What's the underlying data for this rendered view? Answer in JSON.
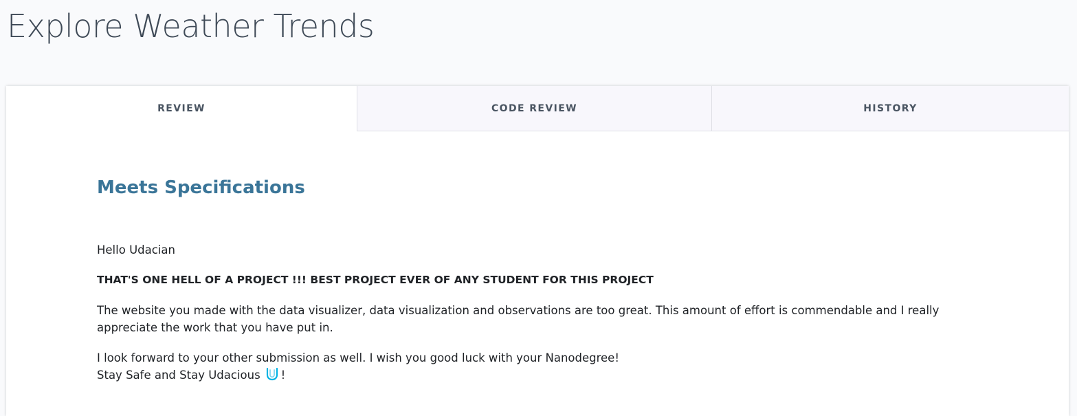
{
  "page": {
    "title": "Explore Weather Trends"
  },
  "tabs": [
    {
      "label": "REVIEW",
      "active": true
    },
    {
      "label": "CODE REVIEW",
      "active": false
    },
    {
      "label": "HISTORY",
      "active": false
    }
  ],
  "review": {
    "result": "Meets Specifications",
    "greeting": "Hello Udacian",
    "headline": "THAT'S ONE HELL OF A PROJECT !!! BEST PROJECT EVER OF ANY STUDENT FOR THIS PROJECT",
    "paragraph": "The website you made with the data visualizer, data visualization and observations are too great. This amount of effort is commendable and I really appreciate the work that you have put in.",
    "closing_line1": "I look forward to your other submission as well. I wish you good luck with your Nanodegree!",
    "closing_line2": "Stay Safe and Stay Udacious",
    "closing_suffix": "!",
    "logo_icon": "udacity-u-icon"
  },
  "colors": {
    "background": "#f9fafc",
    "title": "#3f4a57",
    "accent": "#3a7598",
    "logo": "#02b3e4"
  }
}
